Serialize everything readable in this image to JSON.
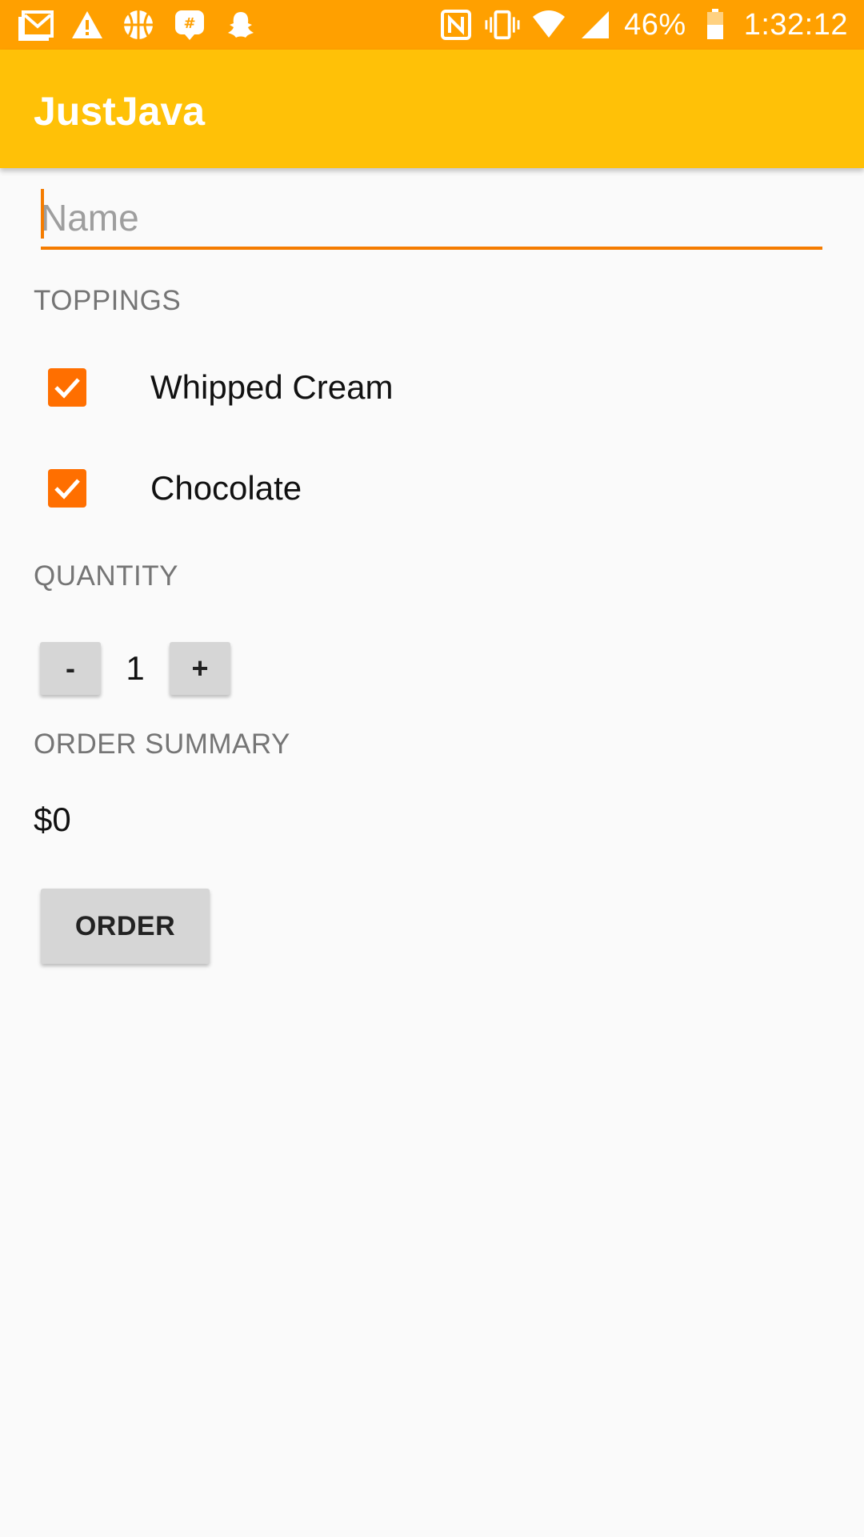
{
  "status_bar": {
    "battery_percent": "46%",
    "time": "1:32:12",
    "left_icons": [
      "gmail-icon",
      "warning-icon",
      "basketball-icon",
      "groupme-icon",
      "snapchat-icon"
    ],
    "right_icons": [
      "nfc-icon",
      "vibrate-icon",
      "wifi-icon",
      "signal-icon",
      "battery-icon"
    ]
  },
  "app_bar": {
    "title": "JustJava"
  },
  "name_input": {
    "placeholder": "Name",
    "value": ""
  },
  "toppings": {
    "label": "TOPPINGS",
    "items": [
      {
        "label": "Whipped Cream",
        "checked": true
      },
      {
        "label": "Chocolate",
        "checked": true
      }
    ]
  },
  "quantity": {
    "label": "QUANTITY",
    "decrement_label": "-",
    "increment_label": "+",
    "value": "1"
  },
  "order_summary": {
    "label": "ORDER SUMMARY",
    "price": "$0"
  },
  "order_button": {
    "label": "ORDER"
  },
  "colors": {
    "status_bar": "#ffa000",
    "app_bar": "#ffc107",
    "accent": "#ff6f00",
    "underline": "#f57c00"
  }
}
